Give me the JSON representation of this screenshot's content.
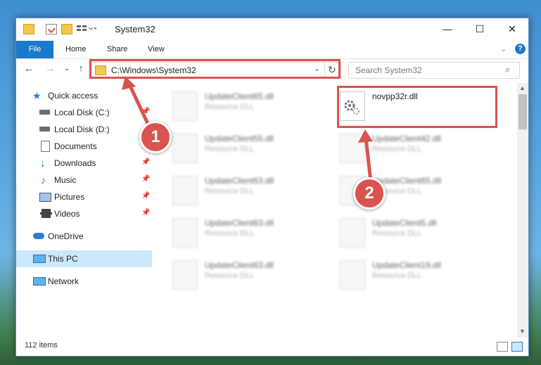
{
  "window": {
    "title": "System32"
  },
  "ribbon": {
    "file": "File",
    "tabs": [
      "Home",
      "Share",
      "View"
    ]
  },
  "address": {
    "path": "C:\\Windows\\System32"
  },
  "search": {
    "placeholder": "Search System32"
  },
  "sidebar": {
    "items": [
      {
        "label": "Quick access",
        "icon": "star-icon"
      },
      {
        "label": "Local Disk (C:)",
        "icon": "drive-icon"
      },
      {
        "label": "Local Disk (D:)",
        "icon": "drive-icon"
      },
      {
        "label": "Documents",
        "icon": "documents-icon"
      },
      {
        "label": "Downloads",
        "icon": "download-icon"
      },
      {
        "label": "Music",
        "icon": "music-icon"
      },
      {
        "label": "Pictures",
        "icon": "pictures-icon"
      },
      {
        "label": "Videos",
        "icon": "videos-icon"
      },
      {
        "label": "OneDrive",
        "icon": "cloud-icon"
      },
      {
        "label": "This PC",
        "icon": "computer-icon"
      },
      {
        "label": "Network",
        "icon": "network-icon"
      }
    ]
  },
  "files": {
    "left": [
      {
        "name": "UpdateClient65.dll",
        "type": "Resource DLL"
      },
      {
        "name": "UpdateClient55.dll",
        "type": "Resource DLL"
      },
      {
        "name": "UpdateClient63.dll",
        "type": "Resource DLL"
      },
      {
        "name": "UpdateClient63.dll",
        "type": "Resource DLL"
      },
      {
        "name": "UpdateClient63.dll",
        "type": "Resource DLL"
      }
    ],
    "right": [
      {
        "name": "novpp32r.dll",
        "type": ""
      },
      {
        "name": "UpdateClient42.dll",
        "type": "Resource DLL"
      },
      {
        "name": "UpdateClient65.dll",
        "type": "Resource DLL"
      },
      {
        "name": "UpdateClient5.dll",
        "type": "Resource DLL"
      },
      {
        "name": "UpdateClient19.dll",
        "type": "Resource DLL"
      }
    ]
  },
  "status": {
    "count": "112 items"
  },
  "annotations": {
    "step1": "1",
    "step2": "2"
  },
  "colors": {
    "accent": "#1979ca",
    "highlight": "#d9534f",
    "selected": "#cce8ff"
  }
}
